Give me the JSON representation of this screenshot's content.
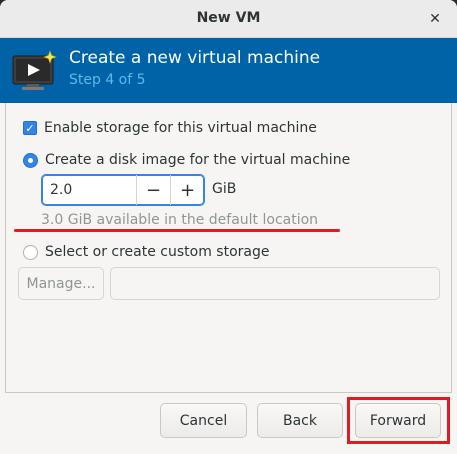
{
  "window": {
    "title": "New VM",
    "close_glyph": "✕"
  },
  "header": {
    "icon": "virtual-machine-monitor-icon",
    "title": "Create a new virtual machine",
    "step": "Step 4 of 5",
    "background": "#0063a7"
  },
  "storage": {
    "enable_label": "Enable storage for this virtual machine",
    "enable_checked": true,
    "create_disk_label": "Create a disk image for the virtual machine",
    "create_disk_selected": true,
    "disk_size_value": "2.0",
    "decrement_glyph": "−",
    "increment_glyph": "+",
    "unit": "GiB",
    "available_text": "3.0 GiB available in the default location",
    "custom_label": "Select or create custom storage",
    "custom_selected": false,
    "manage_label": "Manage...",
    "custom_path_value": ""
  },
  "footer": {
    "cancel_label": "Cancel",
    "back_label": "Back",
    "forward_label": "Forward"
  },
  "annotations": {
    "highlight_color": "#e01b24"
  }
}
